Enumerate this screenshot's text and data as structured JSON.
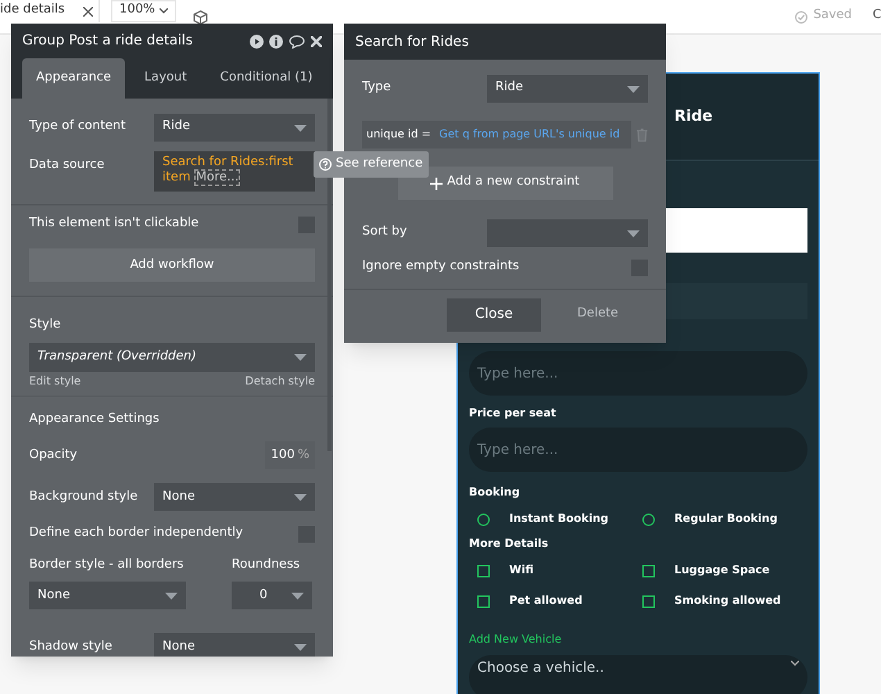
{
  "top_bar": {
    "tab_title": "ide details",
    "zoom": "100%",
    "save_status": "Saved",
    "cut_label": "C"
  },
  "property_panel": {
    "title": "Group Post a ride details",
    "tabs": [
      {
        "label": "Appearance",
        "selected": true
      },
      {
        "label": "Layout",
        "selected": false
      },
      {
        "label": "Conditional (1)",
        "selected": false
      }
    ],
    "type_of_content": {
      "label": "Type of content",
      "value": "Ride"
    },
    "data_source": {
      "label": "Data source",
      "expression": "Search for Rides:first item",
      "more": "More..."
    },
    "not_clickable": {
      "label": "This element isn't clickable",
      "checked": false
    },
    "add_workflow": "Add workflow",
    "style": {
      "label": "Style",
      "value": "Transparent (Overridden)",
      "edit": "Edit style",
      "detach": "Detach style"
    },
    "appearance_settings": "Appearance Settings",
    "opacity": {
      "label": "Opacity",
      "value": "100",
      "unit": "%"
    },
    "background_style": {
      "label": "Background style",
      "value": "None"
    },
    "define_borders": {
      "label": "Define each border independently",
      "checked": false
    },
    "border_style": {
      "label": "Border style - all borders",
      "value": "None"
    },
    "roundness": {
      "label": "Roundness",
      "value": "0"
    },
    "shadow_style": {
      "label": "Shadow style",
      "value": "None"
    }
  },
  "tooltip": "See reference",
  "search_popup": {
    "title": "Search for Rides",
    "type": {
      "label": "Type",
      "value": "Ride"
    },
    "constraint": {
      "field": "unique id =",
      "value": "Get q from page URL's unique id"
    },
    "add_constraint": "Add a new constraint",
    "sort_by": {
      "label": "Sort by"
    },
    "ignore_empty": {
      "label": "Ignore empty constraints",
      "checked": false
    },
    "buttons": [
      "Close",
      "Delete"
    ]
  },
  "canvas_form": {
    "title": "Ride",
    "fields": [
      {
        "placeholder": "Type here..."
      },
      {
        "label": "Price per seat",
        "placeholder": "Type here..."
      }
    ],
    "booking": {
      "label": "Booking",
      "options": [
        {
          "label": "Instant Booking",
          "selected": false
        },
        {
          "label": "Regular Booking",
          "selected": false
        }
      ]
    },
    "details": {
      "label": "More Details",
      "options": [
        {
          "label": "Wifi",
          "checked": false
        },
        {
          "label": "Luggage Space",
          "checked": false
        },
        {
          "label": "Pet allowed",
          "checked": false
        },
        {
          "label": "Smoking allowed",
          "checked": false
        }
      ]
    },
    "add_vehicle": "Add New Vehicle",
    "vehicle_select": "Choose a vehicle.."
  }
}
